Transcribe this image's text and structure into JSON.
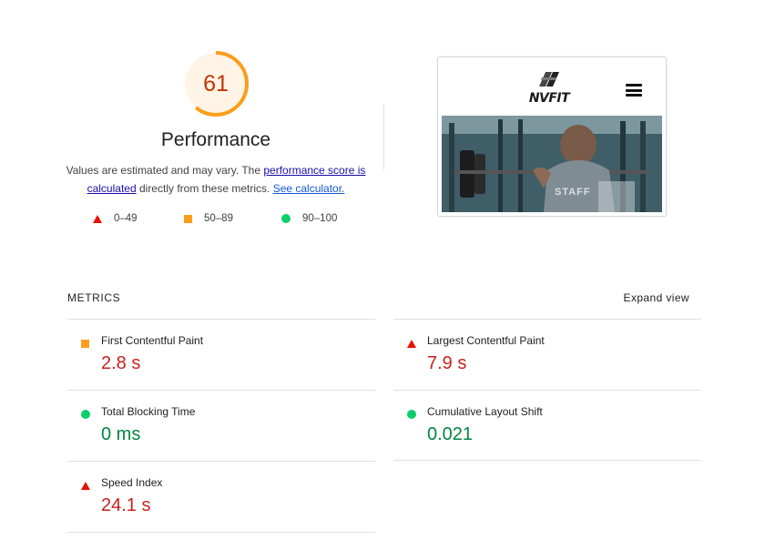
{
  "gauge": {
    "score": "61",
    "score_value": 61,
    "title": "Performance",
    "color": "#fa9e1c",
    "text_color": "#c33300"
  },
  "description": {
    "part1": "Values are estimated and may vary. The ",
    "link1": "performance score is calculated",
    "part2": " directly from these metrics. ",
    "link2": "See calculator."
  },
  "legend": [
    {
      "icon": "fail-triangle-icon",
      "label": "0–49"
    },
    {
      "icon": "average-square-icon",
      "label": "50–89"
    },
    {
      "icon": "pass-circle-icon",
      "label": "90–100"
    }
  ],
  "screenshot": {
    "logo_text": "NVFIT",
    "hero_text": "STAFF"
  },
  "metrics": {
    "header": "METRICS",
    "expand_label": "Expand view",
    "items": [
      {
        "label": "First Contentful Paint",
        "value": "2.8 s",
        "status": "average"
      },
      {
        "label": "Largest Contentful Paint",
        "value": "7.9 s",
        "status": "fail"
      },
      {
        "label": "Total Blocking Time",
        "value": "0 ms",
        "status": "pass"
      },
      {
        "label": "Cumulative Layout Shift",
        "value": "0.021",
        "status": "pass"
      },
      {
        "label": "Speed Index",
        "value": "24.1 s",
        "status": "fail"
      }
    ]
  },
  "colors": {
    "fail": "#eb0f00",
    "average": "#fa9e1c",
    "pass": "#0cce6b",
    "fail_text": "#c7221f",
    "pass_text": "#018642"
  }
}
